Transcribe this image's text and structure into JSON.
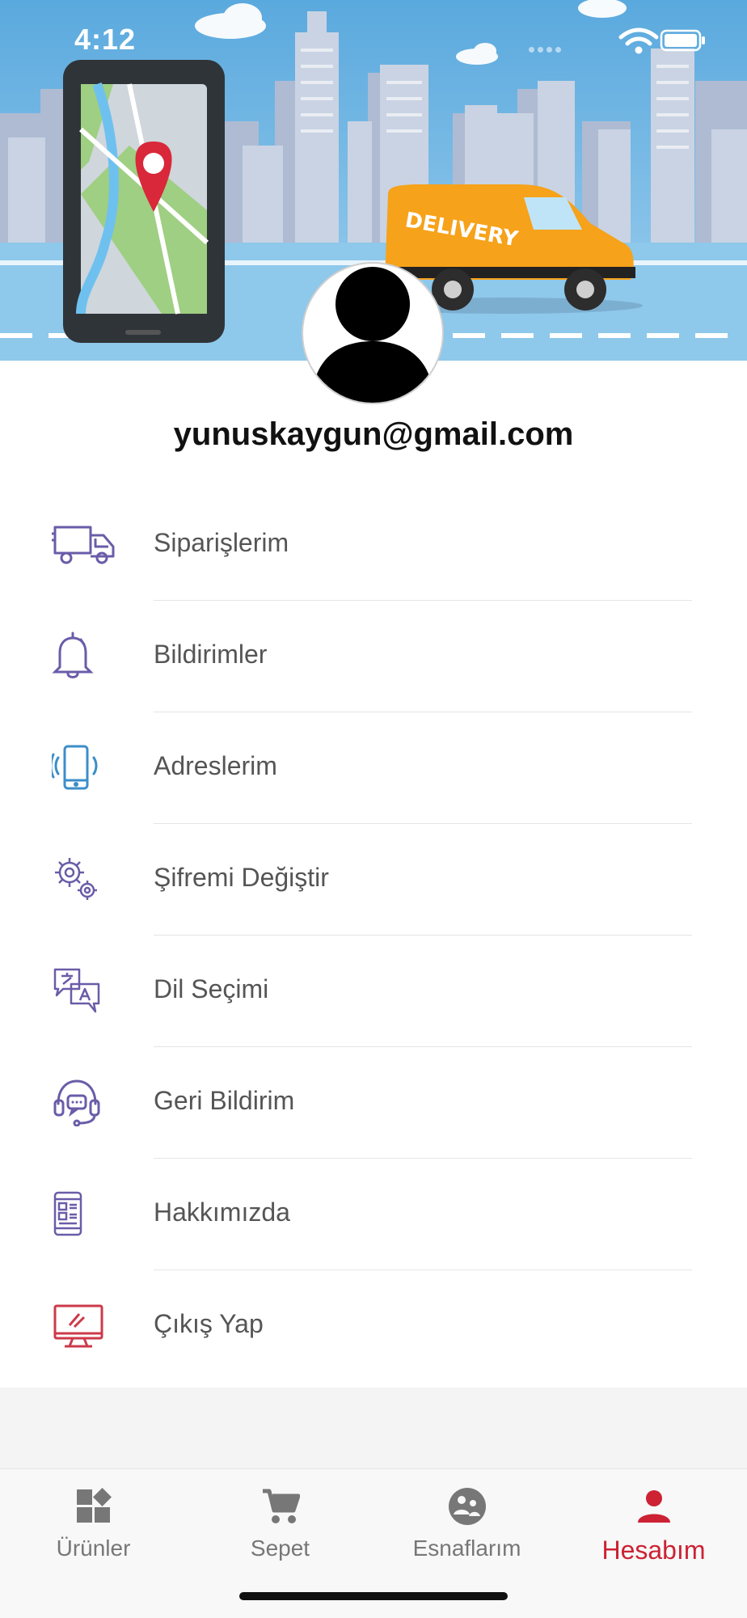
{
  "status_bar": {
    "time": "4:12"
  },
  "banner": {
    "truck_text": "DELIVERY"
  },
  "profile": {
    "email": "yunuskaygun@gmail.com"
  },
  "menu": {
    "items": [
      {
        "label": "Siparişlerim",
        "icon": "delivery-truck-icon"
      },
      {
        "label": "Bildirimler",
        "icon": "bell-icon"
      },
      {
        "label": "Adreslerim",
        "icon": "phone-vibrate-icon"
      },
      {
        "label": "Şifremi Değiştir",
        "icon": "gears-icon"
      },
      {
        "label": "Dil Seçimi",
        "icon": "translate-icon"
      },
      {
        "label": "Geri Bildirim",
        "icon": "headset-icon"
      },
      {
        "label": "Hakkımızda",
        "icon": "info-phone-icon"
      },
      {
        "label": "Çıkış Yap",
        "icon": "monitor-logout-icon"
      }
    ]
  },
  "tabbar": {
    "tabs": [
      {
        "label": "Ürünler",
        "icon": "dashboard-icon",
        "active": false
      },
      {
        "label": "Sepet",
        "icon": "cart-icon",
        "active": false
      },
      {
        "label": "Esnaflarım",
        "icon": "community-icon",
        "active": false
      },
      {
        "label": "Hesabım",
        "icon": "person-icon",
        "active": true
      }
    ]
  },
  "colors": {
    "accent": "#cc2233",
    "menu_icon": "#6a5ca8",
    "sky": "#6eb6e2",
    "truck": "#f6a21a"
  }
}
